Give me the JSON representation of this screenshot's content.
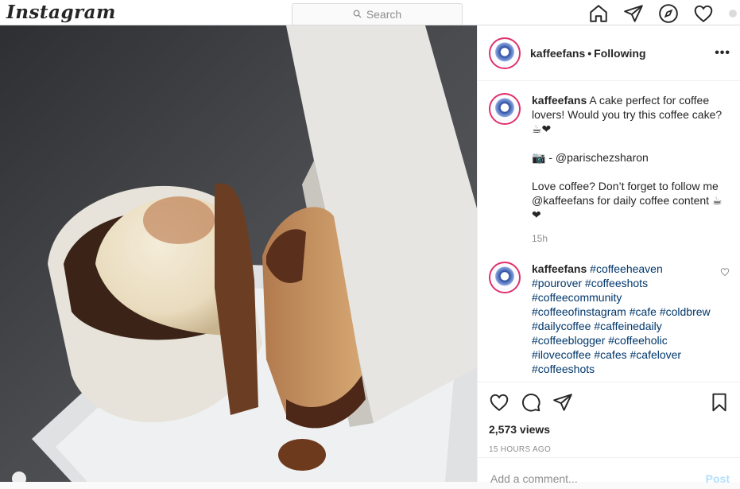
{
  "topbar": {
    "logo": "Instagram",
    "search_placeholder": "Search",
    "icons": [
      "home-icon",
      "direct-icon",
      "explore-icon",
      "activity-heart-icon",
      "profile-icon"
    ]
  },
  "post": {
    "username": "kaffeefans",
    "follow_state": "Following",
    "more_icon": "•••",
    "caption": {
      "username": "kaffeefans",
      "line1": "A cake perfect for coffee lovers! Would you try this coffee cake? ☕❤",
      "line2": "📷 - @parischezsharon",
      "line3": "Love coffee? Don’t forget to follow me @kaffeefans for daily coffee content ☕❤",
      "time": "15h"
    },
    "hashtag_comment": {
      "username": "kaffeefans",
      "tags": "#coffeeheaven #pourover #coffeeshots #coffeecommunity #coffeeofinstagram #cafe #coldbrew #dailycoffee #caffeinedaily #coffeeblogger #coffeeholic #ilovecoffee #cafes #cafelover #coffeeshots"
    },
    "views": "2,573 views",
    "posted_ago": "15 HOURS AGO",
    "comment_placeholder": "Add a comment...",
    "post_label": "Post"
  },
  "colors": {
    "link": "#00376b",
    "post_button": "#b2dffc",
    "story_ring": "#e1306c"
  }
}
